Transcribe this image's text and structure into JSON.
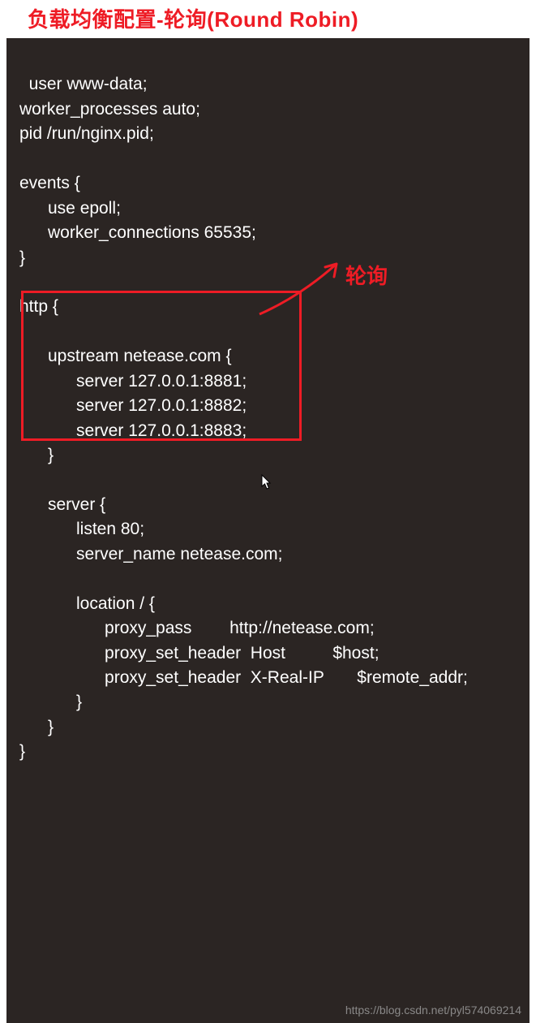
{
  "title": "负载均衡配置-轮询(Round Robin)",
  "annotation": "轮询",
  "watermark": "https://blog.csdn.net/pyl574069214",
  "code": "user www-data;\nworker_processes auto;\npid /run/nginx.pid;\n\nevents {\n      use epoll;\n      worker_connections 65535;\n}\n\nhttp {\n\n      upstream netease.com {\n            server 127.0.0.1:8881;\n            server 127.0.0.1:8882;\n            server 127.0.0.1:8883;\n      }\n\n      server {\n            listen 80;\n            server_name netease.com;\n\n            location / {\n                  proxy_pass        http://netease.com;\n                  proxy_set_header  Host          $host;\n                  proxy_set_header  X-Real-IP       $remote_addr;\n            }\n      }\n}",
  "colors": {
    "accent": "#ee1c25",
    "bg": "#2b2523",
    "fg": "#ffffff"
  }
}
